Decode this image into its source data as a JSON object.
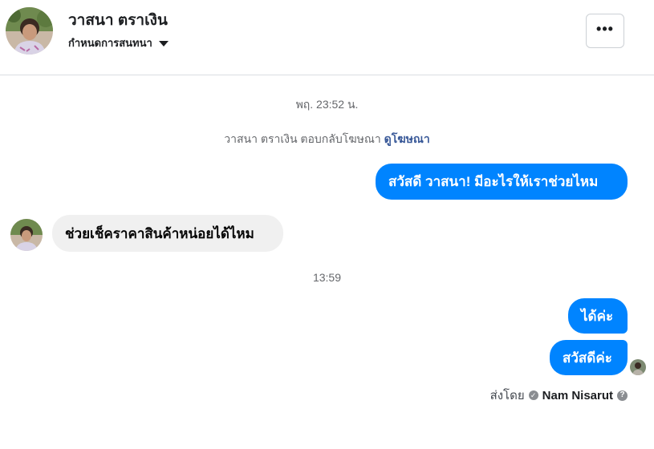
{
  "header": {
    "contact_name": "วาสนา ตราเงิน",
    "manage_label": "กำหนดการสนทนา",
    "more_label": "•••"
  },
  "thread": {
    "timestamp_1": "พฤ. 23:52 น.",
    "ad_reply_text": "วาสนา ตราเงิน ตอบกลับโฆษณา",
    "ad_link_label": "ดูโฆษณา",
    "outgoing_greeting": "สวัสดี วาสนา! มีอะไรให้เราช่วยไหม",
    "incoming_message": "ช่วยเช็คราคาสินค้าหน่อยได้ไหม",
    "timestamp_2": "13:59",
    "outgoing_1": "ได้ค่ะ",
    "outgoing_2": "สวัสดีค่ะ"
  },
  "footer": {
    "sent_by_label": "ส่งโดย",
    "sender_name": "Nam Nisarut",
    "help_icon": "?"
  },
  "colors": {
    "accent": "#0084ff",
    "incoming_bubble": "#f0f0f0",
    "link": "#385898"
  }
}
